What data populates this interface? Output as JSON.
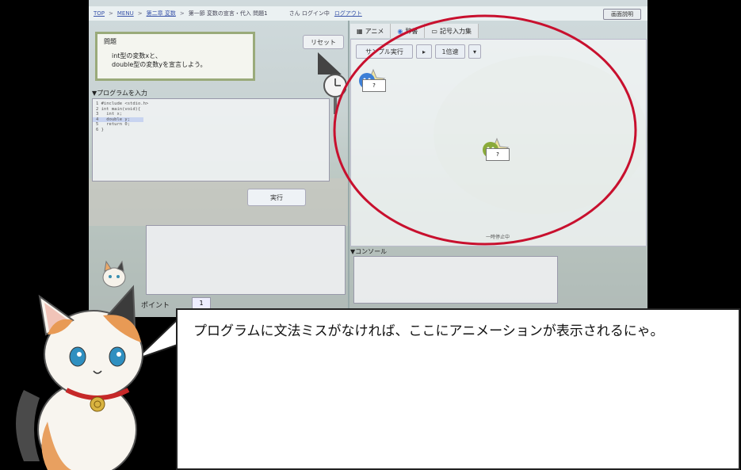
{
  "topbar": {
    "crumb_top": "TOP",
    "crumb_menu": "MENU",
    "crumb_chapter": "第二章 変数",
    "crumb_section": "第一節 変数の宣言・代入 問題1",
    "user_suffix": "さん ログイン中",
    "logout": "ログアウト",
    "help_button": "画面説明"
  },
  "problem": {
    "title": "問題",
    "line1": "int型の変数xと、",
    "line2": "double型の変数yを宣言しよう。"
  },
  "reset_button": "リセット",
  "program_input_label": "▼プログラムを入力",
  "code_lines": [
    {
      "num": "1",
      "text": "#include <stdio.h>"
    },
    {
      "num": "2",
      "text": "int main(void){"
    },
    {
      "num": "3",
      "text": "  int x;"
    },
    {
      "num": "4",
      "text": "  double y;"
    },
    {
      "num": "5",
      "text": "  return 0;"
    },
    {
      "num": "6",
      "text": "}"
    }
  ],
  "run_button": "実行",
  "points": {
    "label": "ポイント",
    "value": "1"
  },
  "tabs": [
    {
      "label": "アニメ",
      "icon": "film-icon"
    },
    {
      "label": "辞書",
      "icon": "book-icon"
    },
    {
      "label": "記号入力集",
      "icon": "keyboard-icon"
    }
  ],
  "anim_toolbar": {
    "sample_run": "サンプル実行",
    "play_symbol": "▸",
    "speed": "1倍速",
    "speed_arrow": "▾"
  },
  "characters": [
    {
      "card": "?",
      "color": "#3d7fd6"
    },
    {
      "card": "?",
      "color": "#8aaa3a"
    }
  ],
  "pause_status": "一時停止中",
  "console_label": "▼コンソール",
  "bubble_text": "プログラムに文法ミスがなければ、ここにアニメーションが表示されるにゃ。",
  "colors": {
    "highlight_ellipse": "#c8102e",
    "problem_border": "#9aaa7a"
  }
}
